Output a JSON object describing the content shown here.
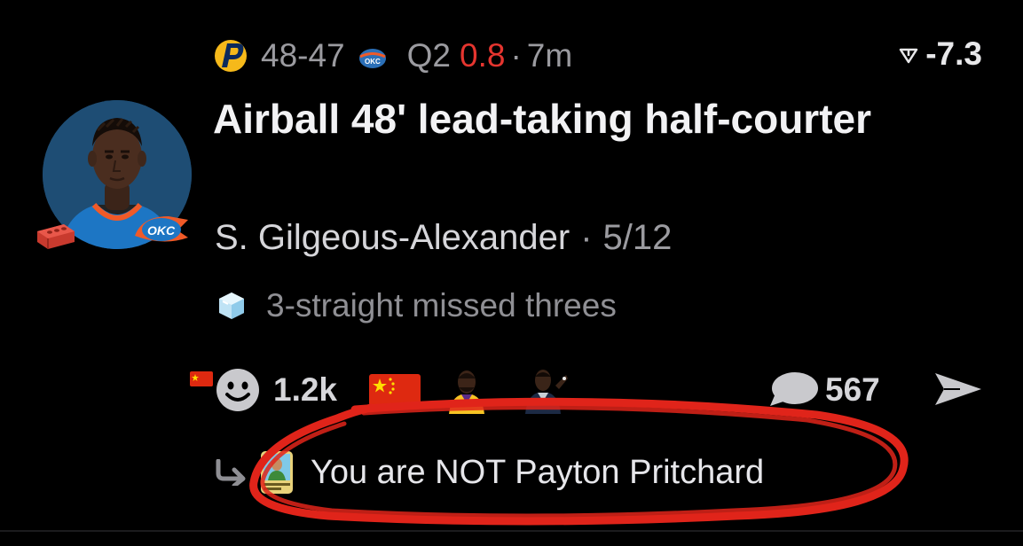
{
  "game": {
    "home_score_label": "48-47",
    "period": "Q2",
    "clock": "0.8",
    "separator": "·",
    "time_ago": "7m",
    "home_team_icon": "pacers-logo-icon",
    "away_team_icon": "thunder-logo-icon"
  },
  "spread": {
    "value": "-7.3",
    "icon": "funnel-icon"
  },
  "post": {
    "headline": "Airball 48' lead-taking half-courter",
    "player": "S. Gilgeous-Alexander",
    "separator": "·",
    "stat": "5/12",
    "streak_icon": "ice-cube-icon",
    "streak_text": "3-straight missed threes",
    "badge_icon": "brick-icon",
    "team_badge": "okc-badge-icon"
  },
  "reactions": {
    "count": "1.2k",
    "comments": "567",
    "icons": [
      "china-flag-icon",
      "smiley-icon",
      "china-flag-icon",
      "lebron-avatar-icon",
      "player-avatar-icon"
    ]
  },
  "reply": {
    "text": "You are NOT Payton Pritchard"
  },
  "colors": {
    "background": "#000000",
    "muted_text": "#9b9ba0",
    "live_red": "#e5352f",
    "annotation_red": "#e0241a",
    "avatar_blue": "#1e4d74"
  }
}
